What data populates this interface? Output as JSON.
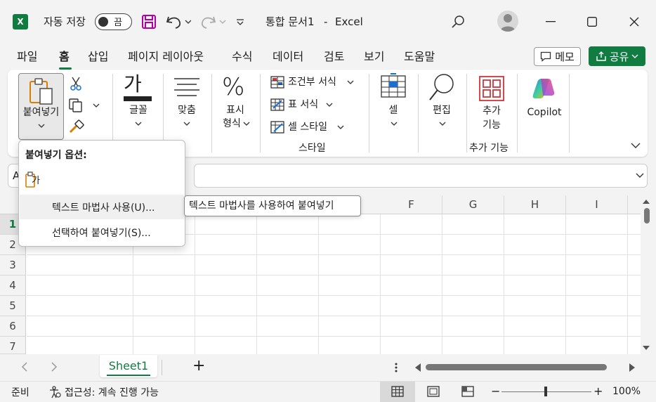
{
  "titlebar": {
    "app_icon": "excel-icon",
    "autosave_label": "자동 저장",
    "autosave_state": "끔",
    "doc_title": "통합 문서1",
    "separator": "-",
    "app_name": "Excel"
  },
  "menu": {
    "tabs": [
      "파일",
      "홈",
      "삽입",
      "페이지 레이아웃",
      "수식",
      "데이터",
      "검토",
      "보기",
      "도움말"
    ],
    "active_tab": "홈",
    "memo_label": "메모",
    "share_label": "공유"
  },
  "ribbon": {
    "paste_label": "붙여넣기",
    "font_label": "글꼴",
    "font_glyph": "가",
    "align_label": "맞춤",
    "number_label_1": "표시",
    "number_label_2": "형식",
    "number_glyph": "%",
    "style_items": [
      "조건부 서식",
      "표 서식",
      "셀 스타일"
    ],
    "style_group": "스타일",
    "cells_label": "셀",
    "edit_label": "편집",
    "addins_label_1": "추가",
    "addins_label_2": "기능",
    "addins_group": "추가 기능",
    "copilot_label": "Copilot"
  },
  "formula_bar": {
    "namebox_value": "A"
  },
  "grid": {
    "columns": [
      "F",
      "G",
      "H",
      "I"
    ],
    "rows": [
      "1",
      "2",
      "3",
      "4",
      "5",
      "6",
      "7"
    ],
    "selected_row": "1"
  },
  "popup": {
    "title": "붙여넣기 옵션:",
    "paste_option_glyph": "가",
    "items": [
      "텍스트 마법사 사용(U)...",
      "선택하여 붙여넣기(S)..."
    ],
    "tooltip": "텍스트 마법사를 사용하여 붙여넣기"
  },
  "sheets": {
    "tabs": [
      "Sheet1"
    ],
    "add_label": "+"
  },
  "status": {
    "mode": "준비",
    "accessibility": "접근성: 계속 진행 가능",
    "zoom_minus": "−",
    "zoom_plus": "+",
    "zoom": "100%"
  },
  "colors": {
    "accent": "#107c41"
  }
}
